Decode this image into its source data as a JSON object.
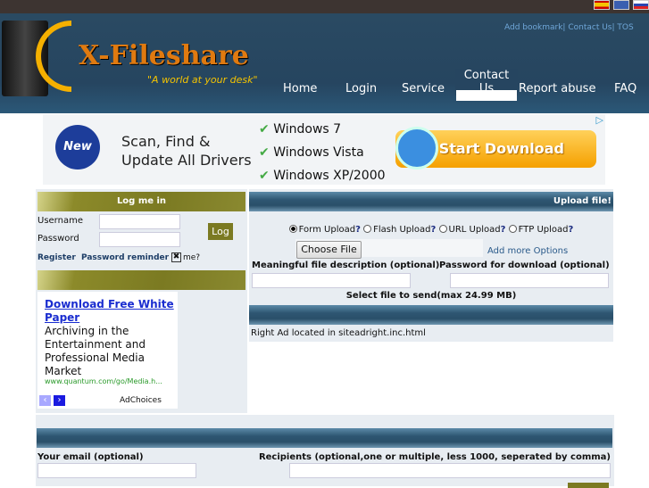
{
  "topbar": {
    "flags": [
      "spain-flag",
      "uk-flag",
      "russia-flag"
    ]
  },
  "header": {
    "logo_text": "X-Fileshare",
    "tagline": "\"A world at your desk\"",
    "top_links": [
      "Add bookmark",
      "Contact Us",
      "TOS"
    ],
    "nav": [
      "Home",
      "Login",
      "Service",
      "Contact Us",
      "Report abuse",
      "FAQ"
    ]
  },
  "banner": {
    "badge": "New",
    "headline": "Scan, Find & Update All Drivers",
    "checks": [
      "Windows 7",
      "Windows Vista",
      "Windows XP/2000"
    ],
    "cta": "Start Download"
  },
  "login": {
    "title": "Log me in",
    "username_label": "Username",
    "password_label": "Password",
    "username_value": "",
    "password_value": "",
    "submit": "Log",
    "register": "Register",
    "reminder": "Password reminder",
    "remember": "me?"
  },
  "ad": {
    "title": "Download Free White Paper",
    "body": "Archiving in the Entertainment and Professional Media Market",
    "url": "www.quantum.com/go/Media.h...",
    "adchoices": "AdChoices"
  },
  "upload": {
    "title": "Upload file!",
    "modes": [
      {
        "label": "Form Upload",
        "selected": true
      },
      {
        "label": "Flash Upload",
        "selected": false
      },
      {
        "label": "URL Upload",
        "selected": false
      },
      {
        "label": "FTP Upload",
        "selected": false
      }
    ],
    "help": "?",
    "choose_file": "Choose File",
    "more_options": "Add more Options",
    "desc_label": "Meaningful file description (optional)",
    "pass_label": "Password for download (optional)",
    "select_note": "Select file to send(max 24.99 MB)",
    "right_ad": "Right Ad located in siteadright.inc.html"
  },
  "email": {
    "email_label": "Your email (optional)",
    "recipients_label": "Recipients (optional,one or multiple, less 1000, seperated by comma)"
  },
  "colors": {
    "header": "#2a4a62",
    "olive": "#7b7a22",
    "link": "#6fa6d8",
    "panel": "#e8edf2"
  }
}
